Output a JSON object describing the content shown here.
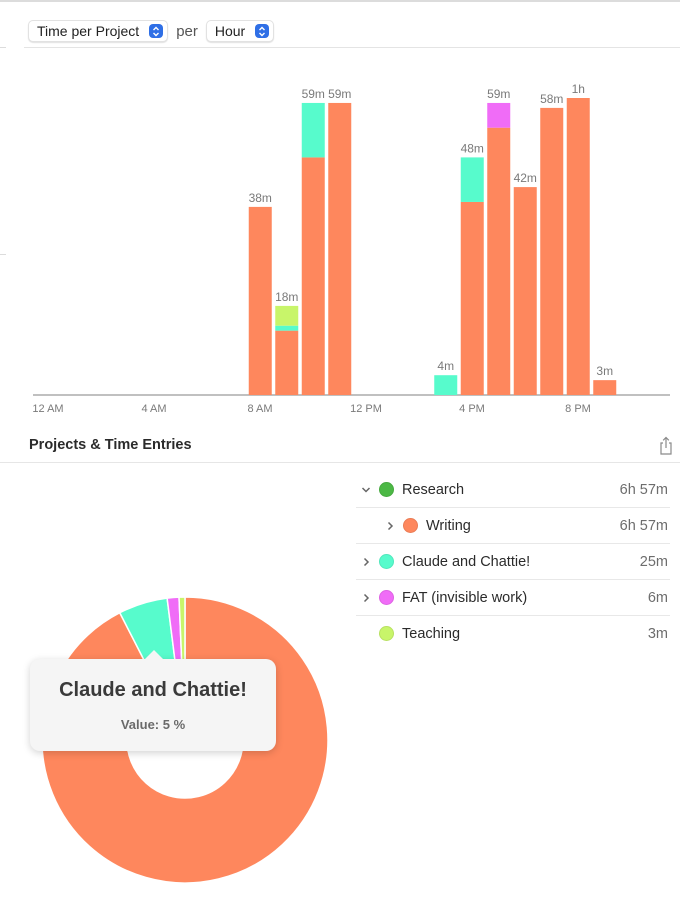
{
  "toolbar": {
    "metric_select": "Time per Project",
    "per_label": "per",
    "interval_select": "Hour"
  },
  "colors": {
    "Research": "#4cb845",
    "Writing": "#fe875d",
    "Claude and Chattie!": "#57fbcc",
    "FAT (invisible work)": "#f06cf7",
    "Teaching": "#c8f56a",
    "axis": "#9a9a9a",
    "label": "#7a7a7a",
    "accent": "#2f6fe6"
  },
  "chart_data": [
    {
      "type": "bar",
      "stacked": true,
      "title": "Time per Project per Hour",
      "xlabel": "",
      "ylabel": "",
      "x_ticks": [
        "12 AM",
        "4 AM",
        "8 AM",
        "12 PM",
        "4 PM",
        "8 PM"
      ],
      "x_tick_hours": [
        0,
        4,
        8,
        12,
        16,
        20
      ],
      "xlim_hours": [
        0,
        24
      ],
      "ylim_minutes": [
        0,
        60
      ],
      "grid": false,
      "series_order": [
        "Writing",
        "Claude and Chattie!",
        "FAT (invisible work)",
        "Teaching"
      ],
      "bars": [
        {
          "hour": 8,
          "label": "38m",
          "segments": {
            "Writing": 38
          }
        },
        {
          "hour": 9,
          "label": "18m",
          "segments": {
            "Writing": 13,
            "Claude and Chattie!": 1,
            "Teaching": 4
          }
        },
        {
          "hour": 10,
          "label": "59m",
          "segments": {
            "Writing": 48,
            "Claude and Chattie!": 11
          }
        },
        {
          "hour": 11,
          "label": "59m",
          "segments": {
            "Writing": 59
          }
        },
        {
          "hour": 15,
          "label": "4m",
          "segments": {
            "Claude and Chattie!": 4
          }
        },
        {
          "hour": 16,
          "label": "48m",
          "segments": {
            "Writing": 39,
            "Claude and Chattie!": 9
          }
        },
        {
          "hour": 17,
          "label": "59m",
          "segments": {
            "Writing": 54,
            "FAT (invisible work)": 5
          }
        },
        {
          "hour": 18,
          "label": "42m",
          "segments": {
            "Writing": 42
          }
        },
        {
          "hour": 19,
          "label": "58m",
          "segments": {
            "Writing": 58
          }
        },
        {
          "hour": 20,
          "label": "1h",
          "segments": {
            "Writing": 60
          }
        },
        {
          "hour": 21,
          "label": "3m",
          "segments": {
            "Writing": 3
          }
        }
      ]
    },
    {
      "type": "pie",
      "donut": true,
      "title": "",
      "slices": [
        {
          "name": "Writing",
          "minutes": 417,
          "percent": 92.5
        },
        {
          "name": "Claude and Chattie!",
          "minutes": 25,
          "percent": 5.5
        },
        {
          "name": "FAT (invisible work)",
          "minutes": 6,
          "percent": 1.3
        },
        {
          "name": "Teaching",
          "minutes": 3,
          "percent": 0.7
        }
      ]
    }
  ],
  "section": {
    "title": "Projects & Time Entries",
    "share_icon": "share-icon"
  },
  "projects": [
    {
      "name": "Research",
      "duration": "6h 57m",
      "color": "#4cb845",
      "level": 0,
      "chevron": "down"
    },
    {
      "name": "Writing",
      "duration": "6h 57m",
      "color": "#fe875d",
      "level": 1,
      "chevron": "right"
    },
    {
      "name": "Claude and Chattie!",
      "duration": "25m",
      "color": "#57fbcc",
      "level": 0,
      "chevron": "right"
    },
    {
      "name": "FAT (invisible work)",
      "duration": "6m",
      "color": "#f06cf7",
      "level": 0,
      "chevron": "right"
    },
    {
      "name": "Teaching",
      "duration": "3m",
      "color": "#c8f56a",
      "level": 0,
      "chevron": "none"
    }
  ],
  "tooltip": {
    "title": "Claude and Chattie!",
    "value": "Value: 5 %"
  }
}
